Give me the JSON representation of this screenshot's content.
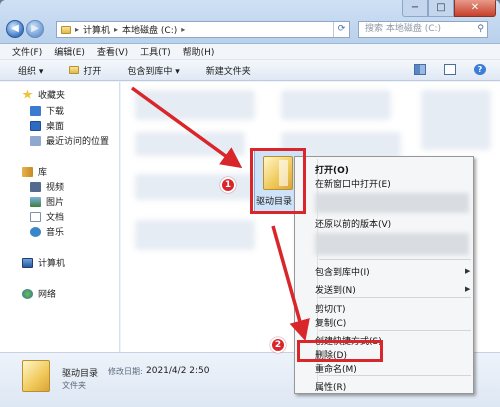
{
  "window": {
    "breadcrumb": [
      "计算机",
      "本地磁盘 (C:)"
    ],
    "search_placeholder": "搜索 本地磁盘 (C:)",
    "controls": {
      "minimize": "−",
      "maximize": "□",
      "close": "✕"
    }
  },
  "menubar": {
    "items": [
      "文件(F)",
      "编辑(E)",
      "查看(V)",
      "工具(T)",
      "帮助(H)"
    ]
  },
  "toolbar": {
    "organize": "组织 ▾",
    "open": "打开",
    "include_library": "包含到库中 ▾",
    "new_folder": "新建文件夹"
  },
  "sidebar": {
    "favorites": "收藏夹",
    "downloads": "下载",
    "desktop": "桌面",
    "recent": "最近访问的位置",
    "libraries": "库",
    "videos": "视频",
    "pictures": "图片",
    "documents": "文档",
    "music": "音乐",
    "computer": "计算机",
    "network": "网络"
  },
  "content": {
    "selected_item": "驱动目录"
  },
  "context_menu": {
    "open": "打开(O)",
    "open_new_window": "在新窗口中打开(E)",
    "restore_previous": "还原以前的版本(V)",
    "include_library": "包含到库中(I)",
    "send_to": "发送到(N)",
    "cut": "剪切(T)",
    "copy": "复制(C)",
    "create_shortcut": "创建快捷方式(S)",
    "delete": "删除(D)",
    "rename": "重命名(M)",
    "properties": "属性(R)"
  },
  "details": {
    "name": "驱动目录",
    "modified_label": "修改日期:",
    "modified_date": "2021/4/2 2:50",
    "type": "文件夹"
  },
  "annotations": {
    "step1": "1",
    "step2": "2",
    "color": "#d8262b"
  }
}
